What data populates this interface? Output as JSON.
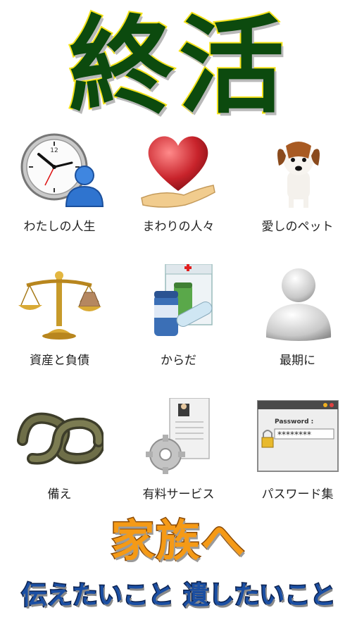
{
  "header": {
    "title": "終活"
  },
  "menu": {
    "items": [
      {
        "label": "わたしの人生",
        "icon": "clock-person-icon"
      },
      {
        "label": "まわりの人々",
        "icon": "heart-hand-icon"
      },
      {
        "label": "愛しのペット",
        "icon": "dog-icon"
      },
      {
        "label": "資産と負債",
        "icon": "scales-icon"
      },
      {
        "label": "からだ",
        "icon": "medicine-icon"
      },
      {
        "label": "最期に",
        "icon": "user-silhouette-icon"
      },
      {
        "label": "備え",
        "icon": "knot-icon"
      },
      {
        "label": "有料サービス",
        "icon": "document-gear-icon"
      },
      {
        "label": "パスワード集",
        "icon": "password-window-icon"
      }
    ]
  },
  "password_icon": {
    "caption": "Password :",
    "mask": "********"
  },
  "footer": {
    "line1": "家族へ",
    "line2a": "伝えたいこと",
    "line2b": "遺したいこと"
  }
}
